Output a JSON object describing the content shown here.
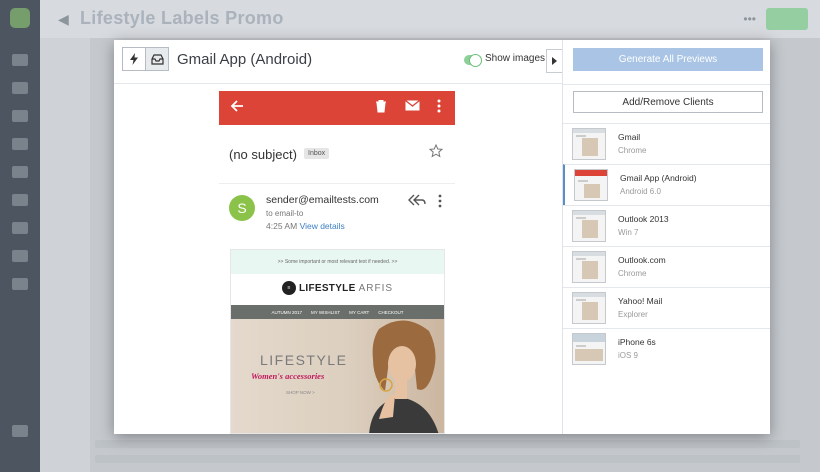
{
  "background": {
    "app_title": "Lifestyle Labels Promo"
  },
  "modal": {
    "client_title": "Gmail App (Android)",
    "show_images_label": "Show images",
    "show_images_on": true,
    "generate_button": "Generate All Previews",
    "add_remove_button": "Add/Remove Clients"
  },
  "preview": {
    "subject": "(no subject)",
    "badge": "Inbox",
    "avatar_letter": "S",
    "sender": "sender@emailtests.com",
    "to": "to email-to",
    "time": "4:25 AM",
    "view_details": "View details",
    "email": {
      "preheader": ">> Some important or most relevant text if needed. >>",
      "brand_bold": "LIFESTYLE",
      "brand_light": "ARFIS",
      "nav": [
        "AUTUMN 2017",
        "MY WISHLIST",
        "MY CART",
        "CHECKOUT"
      ],
      "hero_title": "LIFESTYLE",
      "hero_subtitle": "Women's accessories",
      "hero_link": "SHOP NOW >"
    }
  },
  "clients": [
    {
      "name": "Gmail",
      "detail": "Chrome",
      "selected": false
    },
    {
      "name": "Gmail App (Android)",
      "detail": "Android 6.0",
      "selected": true
    },
    {
      "name": "Outlook 2013",
      "detail": "Win 7",
      "selected": false
    },
    {
      "name": "Outlook.com",
      "detail": "Chrome",
      "selected": false
    },
    {
      "name": "Yahoo! Mail",
      "detail": "Explorer",
      "selected": false
    },
    {
      "name": "iPhone 6s",
      "detail": "iOS 9",
      "selected": false
    }
  ],
  "colors": {
    "gmail_red": "#db4437",
    "accent_blue": "#a9c4e4",
    "toggle_green": "#8fcf9a",
    "avatar_green": "#8bc34a",
    "link_blue": "#3b7fc4"
  }
}
